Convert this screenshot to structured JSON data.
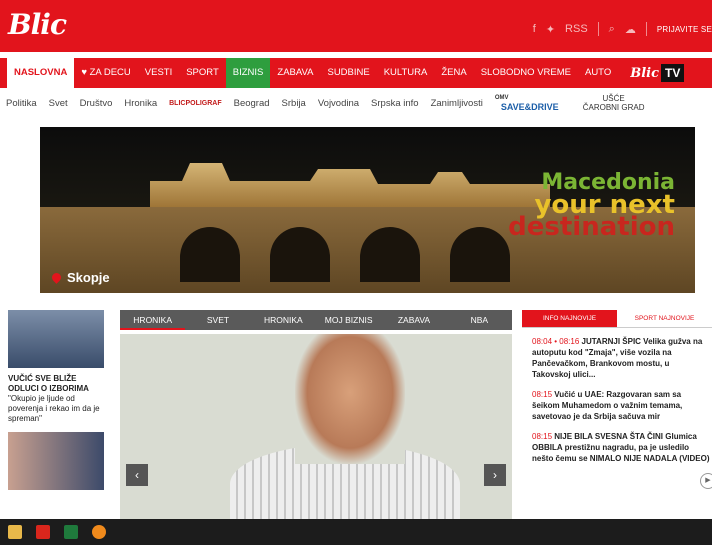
{
  "brand": {
    "logo": "Blic"
  },
  "topbar": {
    "social_fb": "f",
    "social_tw": "🐦",
    "rss": "RSS",
    "login": "PRIJAVITE SE"
  },
  "nav": [
    {
      "label": "NASLOVNA",
      "name": "nav-naslovna"
    },
    {
      "label": "♥ ZA DECU",
      "name": "nav-za-decu"
    },
    {
      "label": "VESTI",
      "name": "nav-vesti"
    },
    {
      "label": "SPORT",
      "name": "nav-sport"
    },
    {
      "label": "BIZNIS",
      "name": "nav-biznis"
    },
    {
      "label": "ZABAVA",
      "name": "nav-zabava"
    },
    {
      "label": "SUDBINE",
      "name": "nav-sudbine"
    },
    {
      "label": "KULTURA",
      "name": "nav-kultura"
    },
    {
      "label": "ŽENA",
      "name": "nav-zena"
    },
    {
      "label": "SLOBODNO VREME",
      "name": "nav-slobodno-vreme"
    },
    {
      "label": "AUTO",
      "name": "nav-auto"
    }
  ],
  "tv": {
    "brand": "Blic",
    "tv": "TV"
  },
  "subnav": [
    "Politika",
    "Svet",
    "Društvo",
    "Hronika",
    "Beograd",
    "Srbija",
    "Vojvodina",
    "Srpska info",
    "Zanimljivosti"
  ],
  "subnav_extras": {
    "poligraf": "BLICPOLIGRAF",
    "save_top": "SAVE&DRIVE",
    "save_small": "OMV",
    "usce_top": "UŠĆE",
    "usce_bottom": "ČAROBNI GRAD"
  },
  "banner": {
    "place": "Skopje",
    "slogan_1": "Macedonia",
    "slogan_2": "your next",
    "slogan_3": "destination"
  },
  "left": {
    "caption_bold": "VUČIĆ SVE BLIŽE ODLUCI O IZBORIMA",
    "caption": "\"Okupio je ljude od poverenja i rekao im da je spreman\""
  },
  "tabs": [
    "HRONIKA",
    "SVET",
    "HRONIKA",
    "MOJ BIZNIS",
    "ZABAVA",
    "NBA"
  ],
  "right": {
    "tab_active": "INFO NAJNOVIJE",
    "tab_other": "SPORT NAJNOVIJE",
    "items": [
      {
        "time": "08:04 • 08:16",
        "text": "JUTARNJI ŠPIC Velika gužva na autoputu kod \"Zmaja\", više vozila na Pančevačkom, Brankovom mostu, u Takovskoj ulici..."
      },
      {
        "time": "08:15",
        "text": "Vučić u UAE: Razgovaran sam sa šeikom Muhamedom o važnim temama, savetovao je da Srbija sačuva mir"
      },
      {
        "time": "08:15",
        "text": "NIJE BILA SVESNA ŠTA ČINI Glumica OBBILA prestižnu nagradu, pa je usledilo nešto čemu se NIMALO NIJE NADALA (VIDEO)"
      }
    ]
  },
  "arrows": {
    "left": "‹",
    "right": "›"
  }
}
